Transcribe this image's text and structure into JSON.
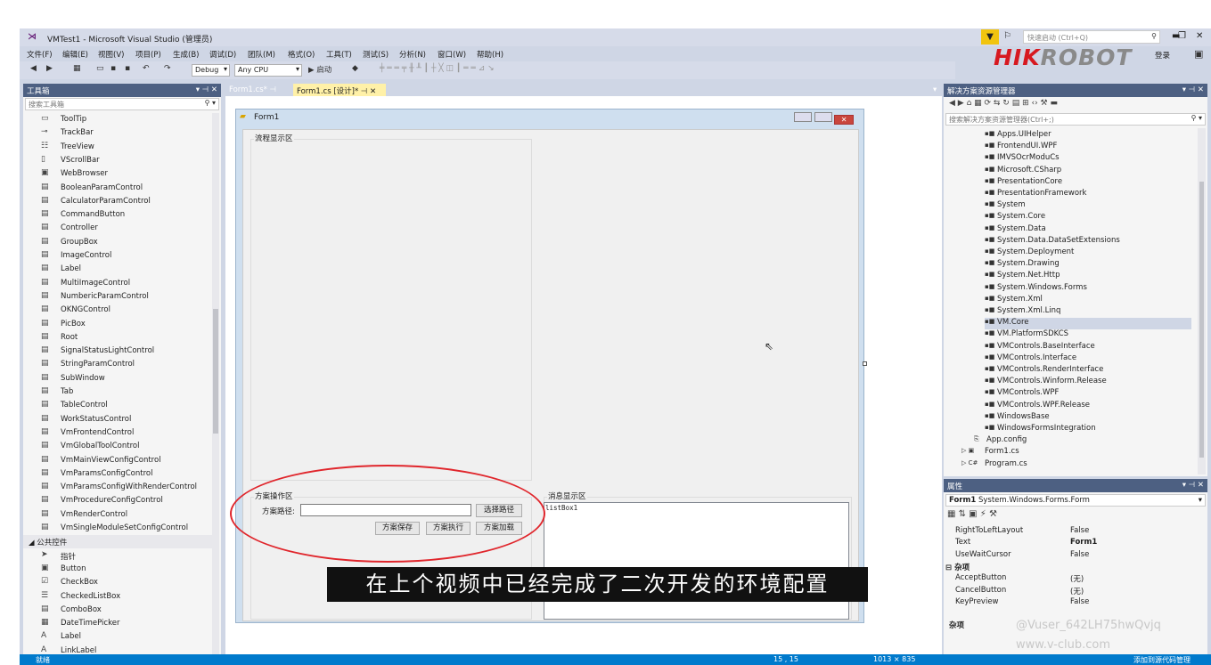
{
  "window": {
    "title": "VMTest1 - Microsoft Visual Studio (管理员)",
    "quick_launch": "快速启动 (Ctrl+Q)",
    "login": "登录",
    "brand_hik": "HIK",
    "brand_robot": "ROBOT"
  },
  "menu": [
    "文件(F)",
    "编辑(E)",
    "视图(V)",
    "项目(P)",
    "生成(B)",
    "调试(D)",
    "团队(M)",
    "格式(O)",
    "工具(T)",
    "测试(S)",
    "分析(N)",
    "窗口(W)",
    "帮助(H)"
  ],
  "toolbar": {
    "config": "Debug",
    "platform": "Any CPU",
    "start": "▶ 启动"
  },
  "toolbox": {
    "title": "工具箱",
    "search": "搜索工具箱",
    "items": [
      "ToolTip",
      "TrackBar",
      "TreeView",
      "VScrollBar",
      "WebBrowser",
      "BooleanParamControl",
      "CalculatorParamControl",
      "CommandButton",
      "Controller",
      "GroupBox",
      "ImageControl",
      "Label",
      "MultiImageControl",
      "NumbericParamControl",
      "OKNGControl",
      "PicBox",
      "Root",
      "SignalStatusLightControl",
      "StringParamControl",
      "SubWindow",
      "Tab",
      "TableControl",
      "WorkStatusControl",
      "VmFrontendControl",
      "VmGlobalToolControl",
      "VmMainViewConfigControl",
      "VmParamsConfigControl",
      "VmParamsConfigWithRenderControl",
      "VmProcedureConfigControl",
      "VmRenderControl",
      "VmSingleModuleSetConfigControl"
    ],
    "section": "◢ 公共控件",
    "common": [
      "指针",
      "Button",
      "CheckBox",
      "CheckedListBox",
      "ComboBox",
      "DateTimePicker",
      "Label",
      "LinkLabel"
    ]
  },
  "tabs": {
    "t1": "Form1.cs*",
    "t2": "Form1.cs [设计]*"
  },
  "form": {
    "title": "Form1",
    "flow": "流程显示区",
    "op": "方案操作区",
    "path_label": "方案路径:",
    "choose": "选择路径",
    "save": "方案保存",
    "run": "方案执行",
    "load": "方案加载",
    "msg": "消息显示区",
    "listbox": "listBox1"
  },
  "solution": {
    "title": "解决方案资源管理器",
    "search": "搜索解决方案资源管理器(Ctrl+;)",
    "refs": [
      "Apps.UIHelper",
      "FrontendUI.WPF",
      "IMVSOcrModuCs",
      "Microsoft.CSharp",
      "PresentationCore",
      "PresentationFramework",
      "System",
      "System.Core",
      "System.Data",
      "System.Data.DataSetExtensions",
      "System.Deployment",
      "System.Drawing",
      "System.Net.Http",
      "System.Windows.Forms",
      "System.Xml",
      "System.Xml.Linq",
      "VM.Core",
      "VM.PlatformSDKCS",
      "VMControls.BaseInterface",
      "VMControls.Interface",
      "VMControls.RenderInterface",
      "VMControls.Winform.Release",
      "VMControls.WPF",
      "VMControls.WPF.Release",
      "WindowsBase",
      "WindowsFormsIntegration"
    ],
    "files": [
      "App.config",
      "Form1.cs",
      "Program.cs"
    ]
  },
  "properties": {
    "title": "属性",
    "object": "Form1",
    "object_type": "System.Windows.Forms.Form",
    "rows": [
      [
        "RightToLeftLayout",
        "False"
      ],
      [
        "Text",
        "Form1"
      ],
      [
        "UseWaitCursor",
        "False"
      ]
    ],
    "category": "⊟ 杂项",
    "rows2": [
      [
        "AcceptButton",
        "(无)"
      ],
      [
        "CancelButton",
        "(无)"
      ],
      [
        "KeyPreview",
        "False"
      ]
    ],
    "desc": "杂项"
  },
  "status": {
    "ready": "就绪",
    "pos": "15 , 15",
    "size": "1013 × 835",
    "right": "添加到源代码管理"
  },
  "subtitle": "在上个视频中已经完成了二次开发的环境配置",
  "watermark": {
    "w1": "@Vuser_642LH75hwQvjq",
    "w2": "www.v-club.com"
  }
}
